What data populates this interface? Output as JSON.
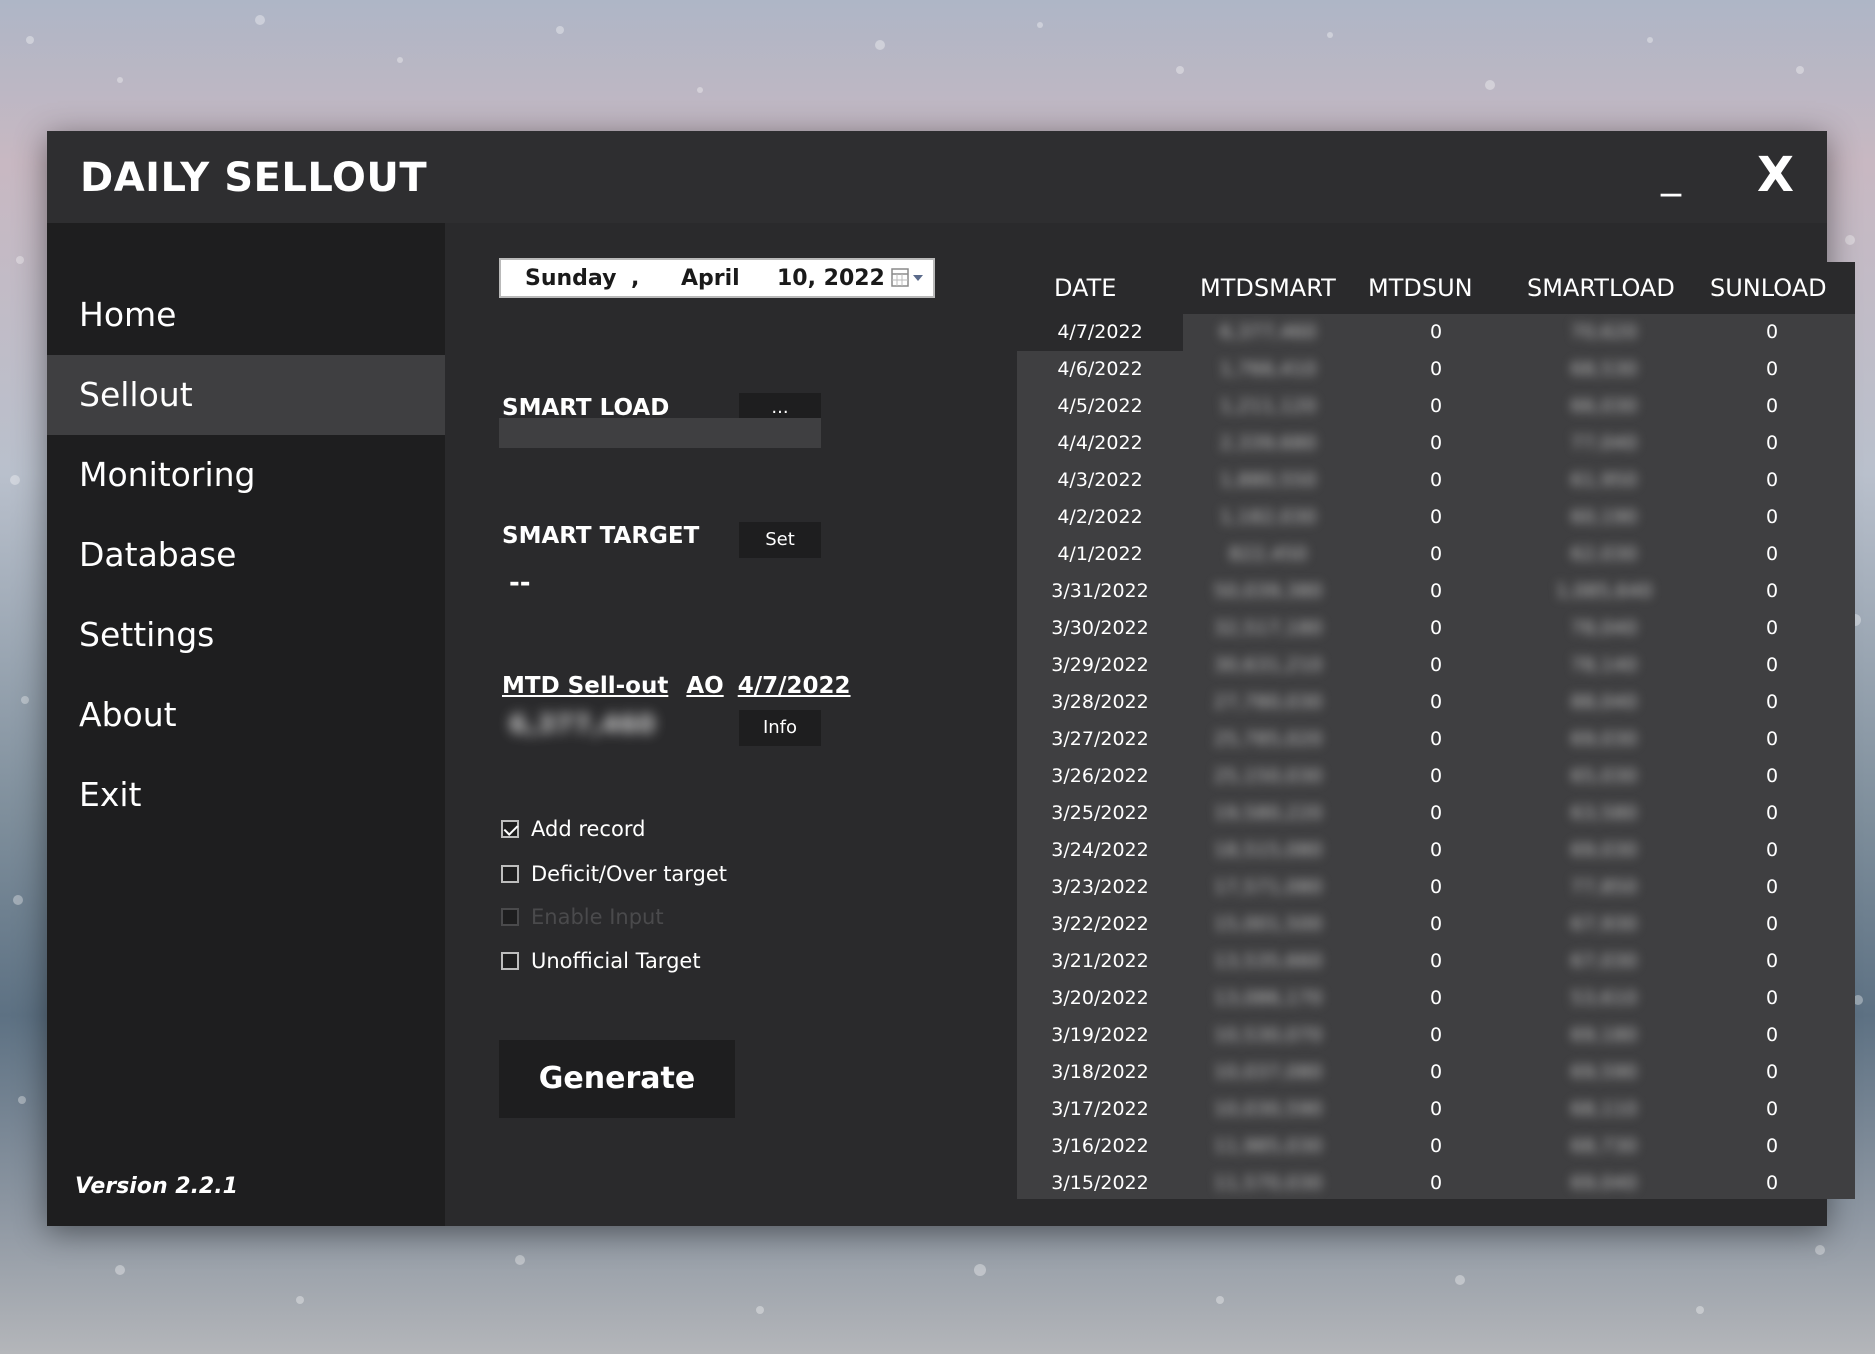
{
  "app": {
    "title": "DAILY SELLOUT",
    "minimize_label": "_",
    "close_label": "X"
  },
  "sidebar": {
    "items": [
      {
        "label": "Home"
      },
      {
        "label": "Sellout",
        "active": true
      },
      {
        "label": "Monitoring"
      },
      {
        "label": "Database"
      },
      {
        "label": "Settings"
      },
      {
        "label": "About"
      },
      {
        "label": "Exit"
      }
    ],
    "version": "Version 2.2.1"
  },
  "date_picker": {
    "weekday": "Sunday",
    "sep": ",",
    "month": "April",
    "day_year": "10, 2022",
    "icon": "calendar-icon"
  },
  "smart_load": {
    "label": "SMART LOAD",
    "button": "..."
  },
  "smart_target": {
    "label": "SMART TARGET",
    "button": "Set",
    "value": "--"
  },
  "mtd": {
    "label": "MTD Sell-out",
    "ao_label": "AO",
    "ao_date": "4/7/2022",
    "value": "6,377,460",
    "button": "Info"
  },
  "checkboxes": [
    {
      "label": "Add record",
      "checked": true,
      "disabled": false
    },
    {
      "label": "Deficit/Over target",
      "checked": false,
      "disabled": false
    },
    {
      "label": "Enable Input",
      "checked": false,
      "disabled": true
    },
    {
      "label": "Unofficial Target",
      "checked": false,
      "disabled": false
    }
  ],
  "generate_label": "Generate",
  "table": {
    "headers": [
      "DATE",
      "MTDSMART",
      "MTDSUN",
      "SMARTLOAD",
      "SUNLOAD"
    ],
    "rows": [
      [
        "4/7/2022",
        "6,377,460",
        "0",
        "70,620",
        "0"
      ],
      [
        "4/6/2022",
        "1,766,410",
        "0",
        "68,530",
        "0"
      ],
      [
        "4/5/2022",
        "1,211,120",
        "0",
        "66,030",
        "0"
      ],
      [
        "4/4/2022",
        "2,339,680",
        "0",
        "77,040",
        "0"
      ],
      [
        "4/3/2022",
        "1,880,550",
        "0",
        "61,950",
        "0"
      ],
      [
        "4/2/2022",
        "1,182,030",
        "0",
        "60,190",
        "0"
      ],
      [
        "4/1/2022",
        "822,450",
        "0",
        "62,030",
        "0"
      ],
      [
        "3/31/2022",
        "50,039,380",
        "0",
        "1,085,640",
        "0"
      ],
      [
        "3/30/2022",
        "32,517,180",
        "0",
        "78,040",
        "0"
      ],
      [
        "3/29/2022",
        "30,631,210",
        "0",
        "78,140",
        "0"
      ],
      [
        "3/28/2022",
        "27,780,030",
        "0",
        "88,040",
        "0"
      ],
      [
        "3/27/2022",
        "25,785,020",
        "0",
        "69,030",
        "0"
      ],
      [
        "3/26/2022",
        "25,150,030",
        "0",
        "65,030",
        "0"
      ],
      [
        "3/25/2022",
        "19,580,220",
        "0",
        "63,580",
        "0"
      ],
      [
        "3/24/2022",
        "18,515,080",
        "0",
        "69,030",
        "0"
      ],
      [
        "3/23/2022",
        "17,571,080",
        "0",
        "77,850",
        "0"
      ],
      [
        "3/22/2022",
        "15,001,500",
        "0",
        "67,930",
        "0"
      ],
      [
        "3/21/2022",
        "13,535,660",
        "0",
        "67,030",
        "0"
      ],
      [
        "3/20/2022",
        "13,086,170",
        "0",
        "53,610",
        "0"
      ],
      [
        "3/19/2022",
        "10,530,070",
        "0",
        "69,180",
        "0"
      ],
      [
        "3/18/2022",
        "10,037,080",
        "0",
        "69,590",
        "0"
      ],
      [
        "3/17/2022",
        "10,030,590",
        "0",
        "68,110",
        "0"
      ],
      [
        "3/16/2022",
        "11,985,030",
        "0",
        "68,730",
        "0"
      ],
      [
        "3/15/2022",
        "11,570,030",
        "0",
        "69,040",
        "0"
      ]
    ]
  }
}
